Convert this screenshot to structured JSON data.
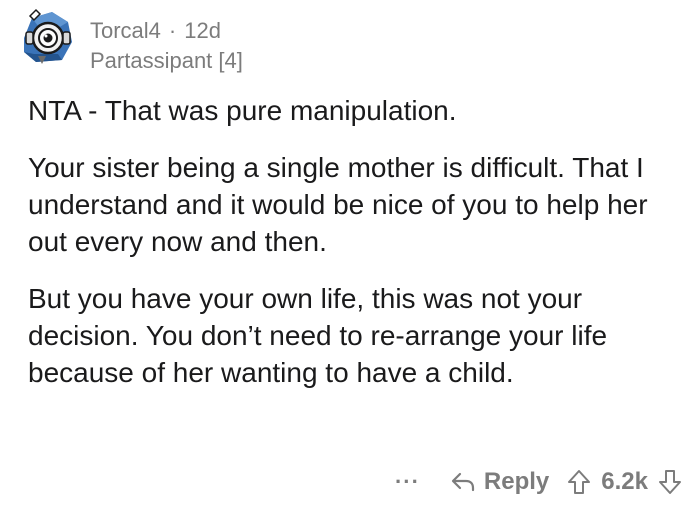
{
  "comment": {
    "username": "Torcal4",
    "separator": "·",
    "age": "12d",
    "flair": "Partassipant [4]",
    "paragraphs": [
      "NTA - That was pure manipulation.",
      "Your sister being a single mother is difficult. That I understand and it would be nice of you to help her out every now and then.",
      "But you have your own life, this was not your decision. You don’t need to re-arrange your life because of her wanting to have a child."
    ],
    "actions": {
      "more": "···",
      "reply_label": "Reply",
      "score": "6.2k"
    }
  },
  "icons": {
    "avatar": "snoo-avatar-icon",
    "reply": "reply-arrow-icon",
    "upvote": "upvote-arrow-icon",
    "downvote": "downvote-arrow-icon"
  },
  "colors": {
    "text": "#1a1a1b",
    "meta": "#7c7c7c",
    "avatar_blue": "#2f6fb5"
  }
}
